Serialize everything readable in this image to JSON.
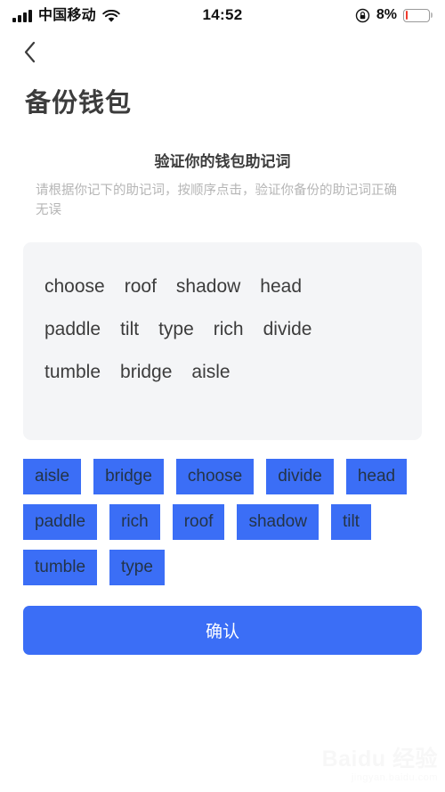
{
  "status_bar": {
    "carrier": "中国移动",
    "signal_icon": "signal-bars-icon",
    "wifi_icon": "wifi-icon",
    "time": "14:52",
    "rotation_lock_icon": "rotation-lock-icon",
    "battery_percent": "8%",
    "battery_level": 8,
    "battery_color": "#f03b2d"
  },
  "nav": {
    "back_icon": "chevron-left-icon"
  },
  "page": {
    "title": "备份钱包",
    "heading": "验证你的钱包助记词",
    "subtitle": "请根据你记下的助记词，按顺序点击，验证你备份的助记词正确无误"
  },
  "mnemonic_panel": {
    "background_color": "#f4f5f7",
    "rows": [
      [
        "choose",
        "roof",
        "shadow",
        "head"
      ],
      [
        "paddle",
        "tilt",
        "type",
        "rich",
        "divide"
      ],
      [
        "tumble",
        "bridge",
        "aisle"
      ]
    ]
  },
  "word_chips": {
    "accent_color": "#3b6ef6",
    "text_color": "#243447",
    "items": [
      "aisle",
      "bridge",
      "choose",
      "divide",
      "head",
      "paddle",
      "rich",
      "roof",
      "shadow",
      "tilt",
      "tumble",
      "type"
    ]
  },
  "confirm": {
    "label": "确认",
    "color": "#3b6ef6"
  },
  "watermark": {
    "main": "Baidu 经验",
    "sub": "jingyan.baidu.com"
  }
}
